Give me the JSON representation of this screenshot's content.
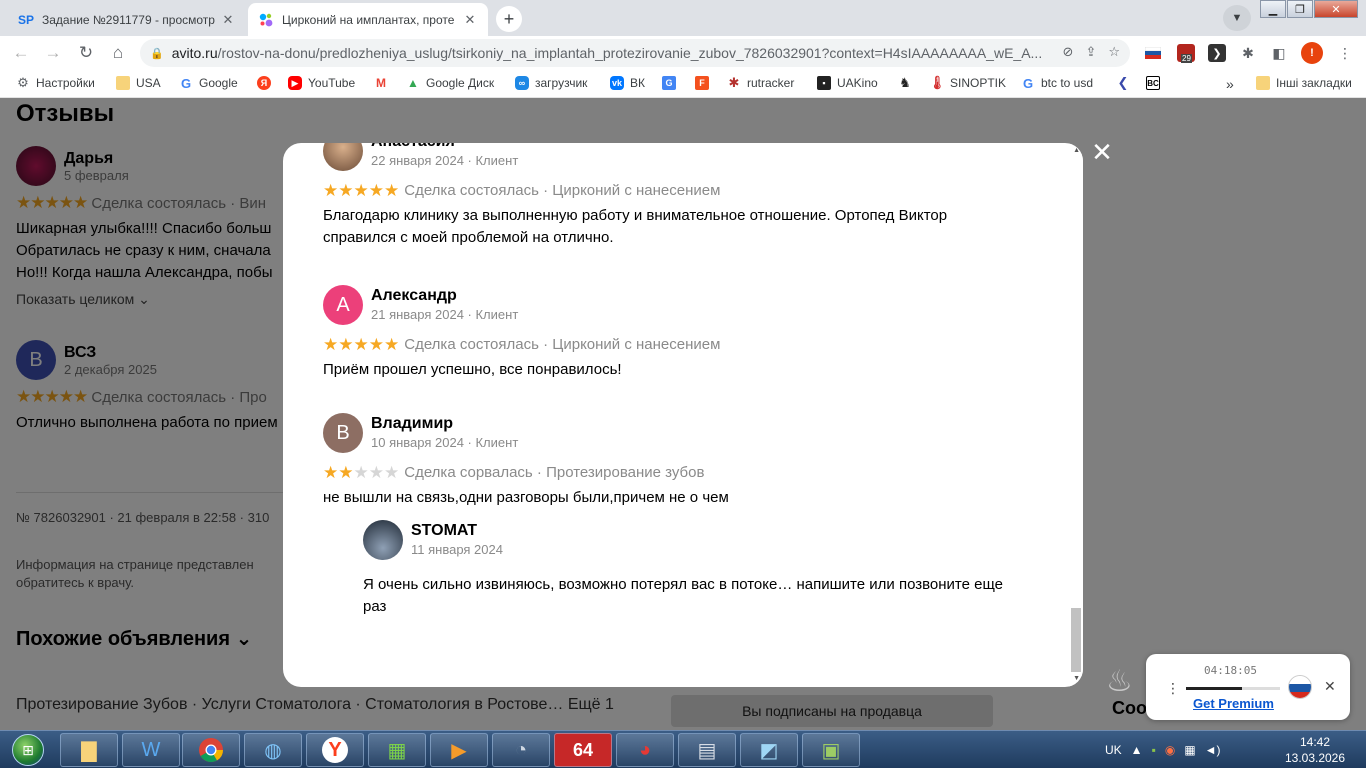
{
  "browser": {
    "tabs": [
      {
        "title": "Задание №2911779 - просмотр",
        "favicon": "SP"
      },
      {
        "title": "Цирконий на имплантах, проте",
        "favicon": "avito-dots"
      }
    ],
    "url_host": "avito.ru",
    "url_rest": "/rostov-na-donu/predlozheniya_uslug/tsirkoniy_na_implantah_protezirovanie_zubov_7826032901?context=H4sIAAAAAAAA_wE_A...",
    "extension_badge": "29",
    "profile_badge": "!",
    "bookmarks": [
      "Настройки",
      "USA",
      "Google",
      "",
      "YouTube",
      "",
      "Google Диск",
      "загрузчик",
      "ВК",
      "",
      "",
      "rutracker",
      "UAKino",
      "",
      "SINOPTIK",
      "btc to usd",
      "",
      ""
    ],
    "bookmarks_other": "Інші закладки",
    "bookmarks_more": "»"
  },
  "background": {
    "heading": "Отзывы",
    "review1": {
      "name": "Дарья",
      "date": "5 февраля",
      "initial": "",
      "deal": "Сделка состоялась · Вин",
      "lines": [
        "Шикарная улыбка!!!! Спасибо больш",
        "Обратилась не сразу к ним, сначала",
        "Но!!! Когда нашла Александра, побы"
      ],
      "more": "Показать целиком"
    },
    "review2": {
      "name": "ВСЗ",
      "date": "2 декабря 2025",
      "initial": "В",
      "deal": "Сделка состоялась · Про",
      "lines": [
        "Отлично выполнена работа по прием"
      ]
    },
    "ad_meta": "№ 7826032901 · 21 февраля в 22:58 · 310",
    "info_line1": "Информация на странице представлен",
    "info_line2": "обратитесь к врачу.",
    "similar": "Похожие объявления",
    "tags": "Протезирование Зубов · Услуги Стоматолога · Стоматология в Ростове… Ещё 1",
    "subscribed": "Вы подписаны на продавца",
    "bottom_right": "Соо"
  },
  "modal": {
    "reviews": [
      {
        "name": "Анастасия",
        "meta": "22 января 2024 · Клиент",
        "rating": 5,
        "deal": "Сделка состоялась · Цирконий с нанесением",
        "text": "Благодарю клинику за выполненную работу и внимательное отношение. Ортопед Виктор справился с моей проблемой на отлично.",
        "initial": "",
        "avatar_color": "#8a6a55"
      },
      {
        "name": "Александр",
        "meta": "21 января 2024 · Клиент",
        "rating": 5,
        "deal": "Сделка состоялась · Цирконий с нанесением",
        "text": "Приём прошел успешно, все понравилось!",
        "initial": "А",
        "avatar_color": "#ec407a"
      },
      {
        "name": "Владимир",
        "meta": "10 января 2024 · Клиент",
        "rating": 2,
        "deal": "Сделка сорвалась · Протезирование зубов",
        "text": "не вышли на связь,одни разговоры были,причем не о чем",
        "initial": "В",
        "avatar_color": "#8d6e63"
      }
    ],
    "reply": {
      "name": "STOMAT",
      "date": "11 января 2024",
      "text": "Я очень сильно извиняюсь, возможно потерял вас в потоке… напишите или позвоните еще раз"
    }
  },
  "vpn_widget": {
    "timer": "04:18:05",
    "progress": 0.6,
    "cta": "Get Premium"
  },
  "taskbar": {
    "lang": "UK",
    "time": "14:42",
    "date": "13.03.2026"
  },
  "colors": {
    "star_filled": "#f6a823",
    "star_empty": "#d6d6d6",
    "accent_link": "#0b57d0"
  }
}
